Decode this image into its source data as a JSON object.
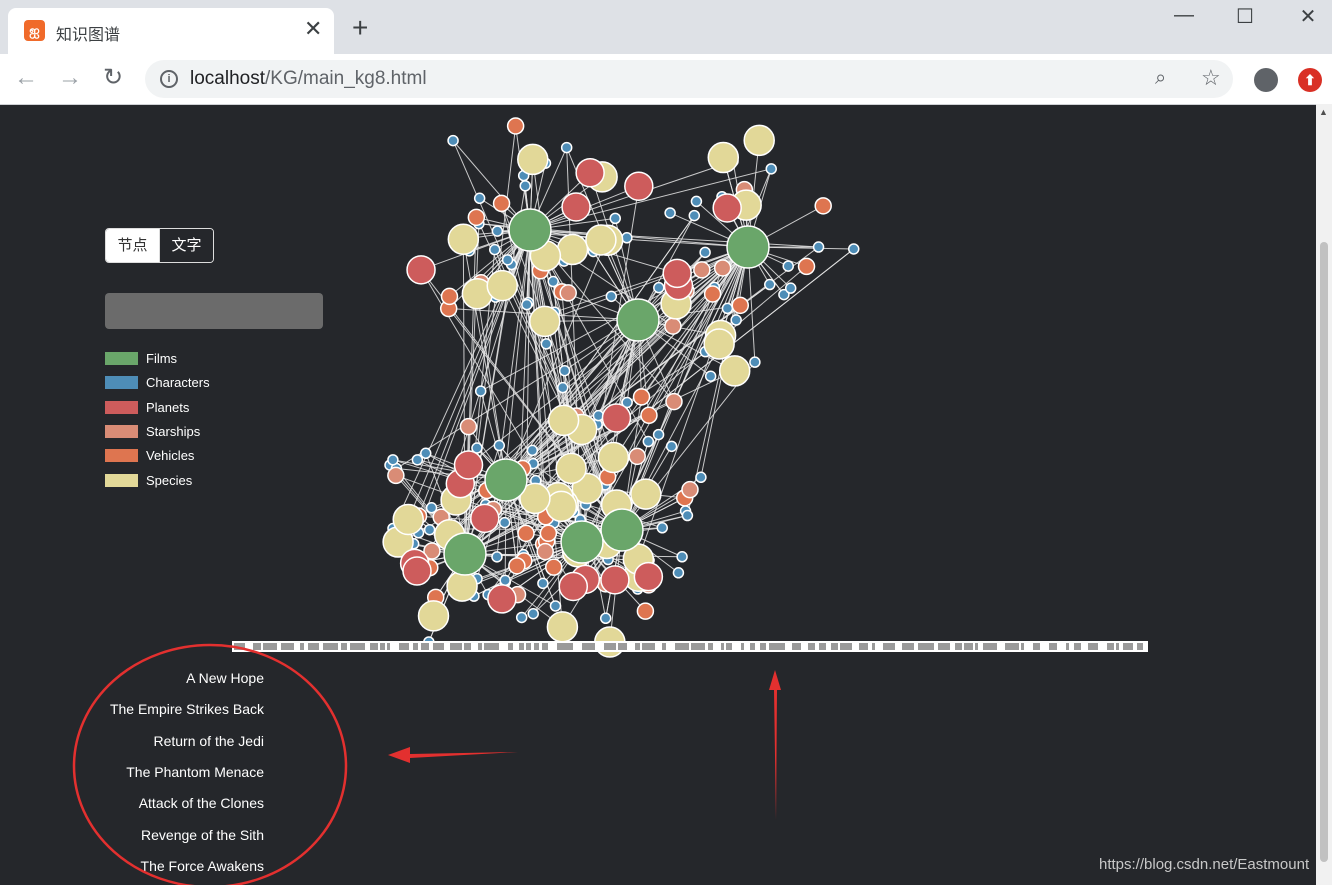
{
  "browser": {
    "tab_title": "知识图谱",
    "tab_icon": "xampp-icon",
    "url_host": "localhost",
    "url_path": "/KG/main_kg8.html",
    "close_label": "✕",
    "new_tab_label": "+"
  },
  "controls": {
    "toggle": [
      "节点",
      "文字"
    ],
    "selected": "节点",
    "search_value": "",
    "search_placeholder": ""
  },
  "legend": [
    {
      "label": "Films",
      "color": "#6aa66a"
    },
    {
      "label": "Characters",
      "color": "#4e8db7"
    },
    {
      "label": "Planets",
      "color": "#cd5c5c"
    },
    {
      "label": "Starships",
      "color": "#d98c76"
    },
    {
      "label": "Vehicles",
      "color": "#de7550"
    },
    {
      "label": "Species",
      "color": "#e2d898"
    }
  ],
  "films": [
    "A New Hope",
    "The Empire Strikes Back",
    "Return of the Jedi",
    "The Phantom Menace",
    "Attack of the Clones",
    "Revenge of the Sith",
    "The Force Awakens"
  ],
  "colors": {
    "background": "#25272b",
    "edge": "#e6e6e6",
    "annotation": "#e3302f",
    "node_stroke": "#ffffff"
  },
  "watermark": "https://blog.csdn.net/Eastmount"
}
